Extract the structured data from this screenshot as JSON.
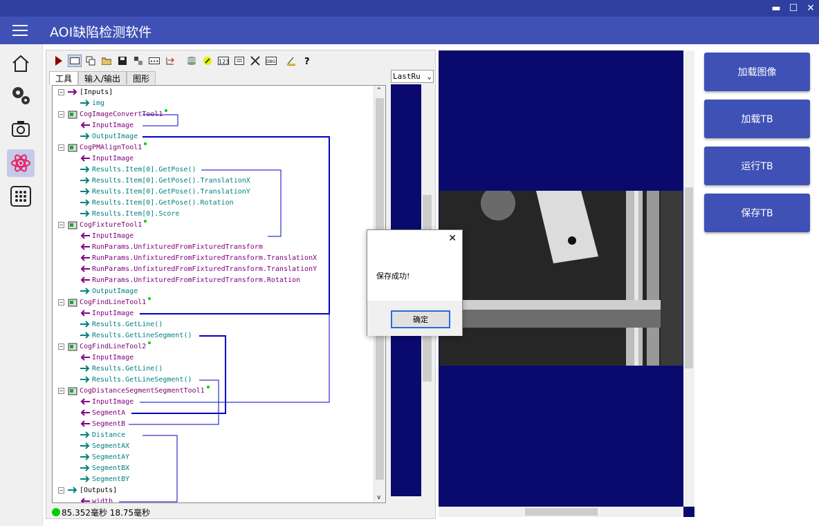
{
  "app": {
    "title": "AOI缺陷检测软件"
  },
  "window_controls": {
    "minimize": "▬",
    "maximize": "☐",
    "close": "✕"
  },
  "nav": [
    {
      "name": "home-icon"
    },
    {
      "name": "settings-icon"
    },
    {
      "name": "camera-icon"
    },
    {
      "name": "atom-icon"
    },
    {
      "name": "grid-icon"
    }
  ],
  "cog": {
    "tabs": [
      "工具",
      "输入/输出",
      "图形"
    ],
    "lastrun": "LastRu",
    "status": "85.352毫秒 18.75毫秒",
    "tree": [
      {
        "text": "[Inputs]",
        "kind": "hdr",
        "lvl": 0
      },
      {
        "text": "img",
        "kind": "out",
        "lvl": 1
      },
      {
        "text": "CogImageConvertTool1",
        "kind": "tool",
        "lvl": 0
      },
      {
        "text": "InputImage",
        "kind": "in",
        "lvl": 1
      },
      {
        "text": "OutputImage",
        "kind": "out",
        "lvl": 1
      },
      {
        "text": "CogPMAlignTool1",
        "kind": "tool",
        "lvl": 0
      },
      {
        "text": "InputImage",
        "kind": "in",
        "lvl": 1
      },
      {
        "text": "Results.Item[0].GetPose()",
        "kind": "out",
        "lvl": 1
      },
      {
        "text": "Results.Item[0].GetPose().TranslationX",
        "kind": "out",
        "lvl": 1
      },
      {
        "text": "Results.Item[0].GetPose().TranslationY",
        "kind": "out",
        "lvl": 1
      },
      {
        "text": "Results.Item[0].GetPose().Rotation",
        "kind": "out",
        "lvl": 1
      },
      {
        "text": "Results.Item[0].Score",
        "kind": "out",
        "lvl": 1
      },
      {
        "text": "CogFixtureTool1",
        "kind": "tool",
        "lvl": 0
      },
      {
        "text": "InputImage",
        "kind": "in",
        "lvl": 1
      },
      {
        "text": "RunParams.UnfixturedFromFixturedTransform",
        "kind": "in",
        "lvl": 1
      },
      {
        "text": "RunParams.UnfixturedFromFixturedTransform.TranslationX",
        "kind": "in",
        "lvl": 1
      },
      {
        "text": "RunParams.UnfixturedFromFixturedTransform.TranslationY",
        "kind": "in",
        "lvl": 1
      },
      {
        "text": "RunParams.UnfixturedFromFixturedTransform.Rotation",
        "kind": "in",
        "lvl": 1
      },
      {
        "text": "OutputImage",
        "kind": "out",
        "lvl": 1
      },
      {
        "text": "CogFindLineTool1",
        "kind": "tool",
        "lvl": 0
      },
      {
        "text": "InputImage",
        "kind": "in",
        "lvl": 1
      },
      {
        "text": "Results.GetLine()",
        "kind": "out",
        "lvl": 1
      },
      {
        "text": "Results.GetLineSegment()",
        "kind": "out",
        "lvl": 1
      },
      {
        "text": "CogFindLineTool2",
        "kind": "tool",
        "lvl": 0
      },
      {
        "text": "InputImage",
        "kind": "in",
        "lvl": 1
      },
      {
        "text": "Results.GetLine()",
        "kind": "out",
        "lvl": 1
      },
      {
        "text": "Results.GetLineSegment()",
        "kind": "out",
        "lvl": 1
      },
      {
        "text": "CogDistanceSegmentSegmentTool1",
        "kind": "tool",
        "lvl": 0
      },
      {
        "text": "InputImage",
        "kind": "in",
        "lvl": 1
      },
      {
        "text": "SegmentA",
        "kind": "in",
        "lvl": 1
      },
      {
        "text": "SegmentB",
        "kind": "in",
        "lvl": 1
      },
      {
        "text": "Distance",
        "kind": "out",
        "lvl": 1
      },
      {
        "text": "SegmentAX",
        "kind": "out",
        "lvl": 1
      },
      {
        "text": "SegmentAY",
        "kind": "out",
        "lvl": 1
      },
      {
        "text": "SegmentBX",
        "kind": "out",
        "lvl": 1
      },
      {
        "text": "SegmentBY",
        "kind": "out",
        "lvl": 1
      },
      {
        "text": "[Outputs]",
        "kind": "hdr",
        "lvl": 0
      },
      {
        "text": "width",
        "kind": "in",
        "lvl": 1
      }
    ]
  },
  "actions": [
    {
      "label": "加载图像",
      "name": "load-image-button"
    },
    {
      "label": "加载TB",
      "name": "load-tb-button"
    },
    {
      "label": "运行TB",
      "name": "run-tb-button"
    },
    {
      "label": "保存TB",
      "name": "save-tb-button"
    }
  ],
  "dialog": {
    "message": "保存成功!",
    "ok": "确定",
    "close": "✕"
  },
  "colors": {
    "primary": "#3f51b5",
    "titlebar": "#2f3f9f",
    "image_bg": "#0a0a6e"
  }
}
